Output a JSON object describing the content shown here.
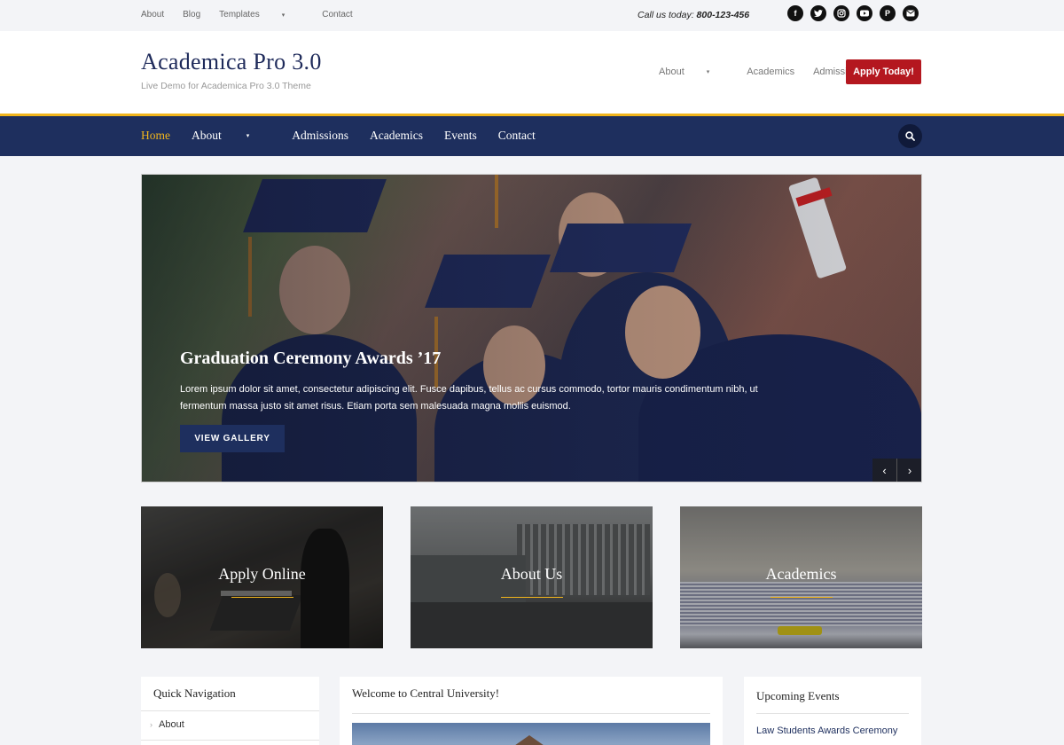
{
  "topbar": {
    "links": [
      {
        "label": "About",
        "has_dropdown": false
      },
      {
        "label": "Blog",
        "has_dropdown": false
      },
      {
        "label": "Templates",
        "has_dropdown": true
      },
      {
        "label": "Contact",
        "has_dropdown": false
      }
    ],
    "call_prefix": "Call us today:",
    "phone": "800-123-456",
    "social_icons": [
      "facebook-icon",
      "twitter-icon",
      "instagram-icon",
      "youtube-icon",
      "pinterest-icon",
      "email-icon"
    ]
  },
  "header": {
    "site_title": "Academica Pro 3.0",
    "site_description": "Live Demo for Academica Pro 3.0 Theme",
    "nav": [
      {
        "label": "About",
        "has_dropdown": true
      },
      {
        "label": "Academics",
        "has_dropdown": false
      },
      {
        "label": "Admissions",
        "has_dropdown": false
      }
    ],
    "cta_label": "Apply Today!",
    "cta_color": "#b4171f"
  },
  "main_nav": {
    "items": [
      {
        "label": "Home",
        "active": true,
        "has_dropdown": false
      },
      {
        "label": "About",
        "active": false,
        "has_dropdown": true
      },
      {
        "label": "Admissions",
        "active": false,
        "has_dropdown": false
      },
      {
        "label": "Academics",
        "active": false,
        "has_dropdown": false
      },
      {
        "label": "Events",
        "active": false,
        "has_dropdown": false
      },
      {
        "label": "Contact",
        "active": false,
        "has_dropdown": false
      }
    ],
    "bar_color": "#1e2f5e",
    "accent_color": "#f1b51c",
    "search_icon": "search-icon"
  },
  "hero": {
    "title": "Graduation Ceremony Awards ’17",
    "text": "Lorem ipsum dolor sit amet, consectetur adipiscing elit. Fusce dapibus, tellus ac cursus commodo, tortor mauris condimentum nibh, ut fermentum massa justo sit amet risus. Etiam porta sem malesuada magna mollis euismod.",
    "button_label": "VIEW GALLERY",
    "prev_icon": "chevron-left-icon",
    "next_icon": "chevron-right-icon"
  },
  "cards": [
    {
      "label": "Apply Online"
    },
    {
      "label": "About Us"
    },
    {
      "label": "Academics"
    }
  ],
  "widgets": {
    "quick_nav": {
      "title": "Quick Navigation",
      "links": [
        "About"
      ]
    },
    "welcome": {
      "title": "Welcome to Central University!"
    },
    "events": {
      "title": "Upcoming Events",
      "items": [
        "Law Students Awards Ceremony"
      ]
    }
  }
}
